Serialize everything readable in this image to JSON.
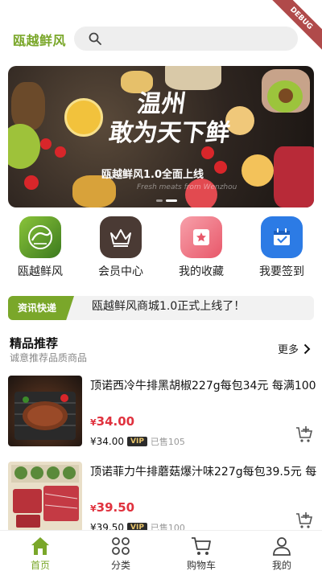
{
  "header": {
    "logo": "瓯越鲜风",
    "search_placeholder": "",
    "debug_ribbon": "DEBUG"
  },
  "banner": {
    "title_line1": "温州",
    "title_line2": "敢为天下鲜",
    "subtitle": "瓯越鲜风1.0全面上线",
    "tagline": "Fresh meats from Wenzhou",
    "slide_count": 2,
    "active_slide": 2
  },
  "menu": [
    {
      "label": "瓯越鲜风",
      "icon": "brand-logo-icon",
      "color": "#5a9a2a"
    },
    {
      "label": "会员中心",
      "icon": "crown-icon",
      "color": "#4a3a34"
    },
    {
      "label": "我的收藏",
      "icon": "favorite-star-icon",
      "color": "#f07a8a"
    },
    {
      "label": "我要签到",
      "icon": "calendar-check-icon",
      "color": "#2c7be5"
    }
  ],
  "news": {
    "tag": "资讯快递",
    "text": "瓯越鲜风商城1.0正式上线了！"
  },
  "section": {
    "title": "精品推荐",
    "subtitle": "诚意推荐品质商品",
    "more": "更多"
  },
  "products": [
    {
      "name": "顶诺西冷牛排黑胡椒227g每包34元 每满100",
      "price": "34.00",
      "vip_price": "¥34.00",
      "vip_label": "VIP",
      "sold": "已售105"
    },
    {
      "name": "顶诺菲力牛排蘑菇爆汁味227g每包39.5元 每",
      "price": "39.50",
      "vip_price": "¥39.50",
      "vip_label": "VIP",
      "sold": "已售100"
    }
  ],
  "currency": "¥",
  "tabs": [
    {
      "label": "首页",
      "icon": "home-icon",
      "active": true
    },
    {
      "label": "分类",
      "icon": "category-grid-icon",
      "active": false
    },
    {
      "label": "购物车",
      "icon": "shopping-cart-icon",
      "active": false
    },
    {
      "label": "我的",
      "icon": "user-profile-icon",
      "active": false
    }
  ],
  "colors": {
    "brand_green": "#7aa72a",
    "price_red": "#e0323e"
  }
}
